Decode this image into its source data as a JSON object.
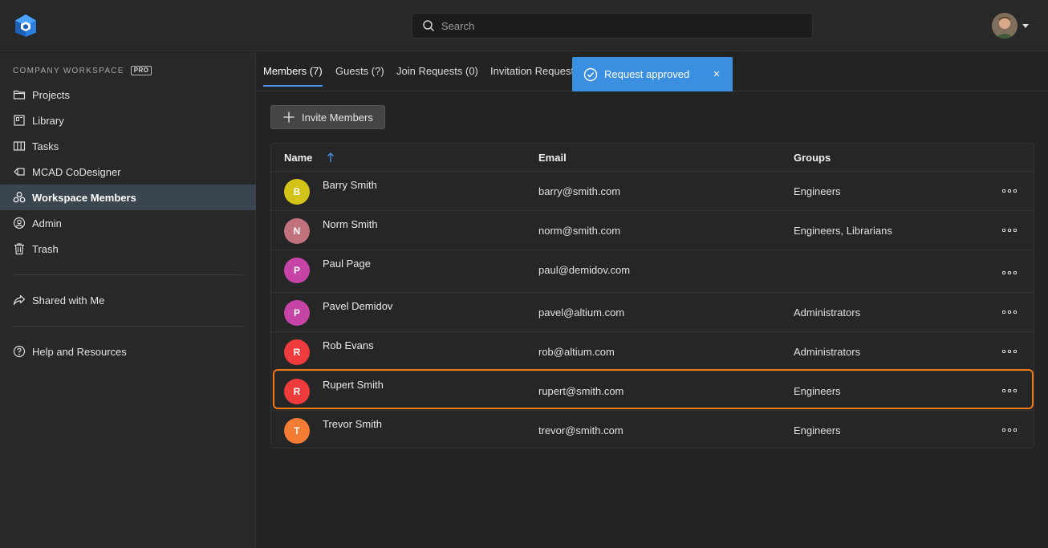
{
  "header": {
    "search_placeholder": "Search"
  },
  "sidebar": {
    "workspace_label": "COMPANY WORKSPACE",
    "pro_badge": "PRO",
    "items": [
      {
        "label": "Projects",
        "icon": "folder-icon"
      },
      {
        "label": "Library",
        "icon": "library-icon"
      },
      {
        "label": "Tasks",
        "icon": "tasks-board-icon"
      },
      {
        "label": "MCAD CoDesigner",
        "icon": "mcad-icon"
      },
      {
        "label": "Workspace Members",
        "icon": "members-icon",
        "active": true
      },
      {
        "label": "Admin",
        "icon": "admin-user-icon"
      },
      {
        "label": "Trash",
        "icon": "trash-icon"
      }
    ],
    "shared_label": "Shared with Me",
    "help_label": "Help and Resources"
  },
  "tabs": [
    {
      "label": "Members (7)",
      "active": true
    },
    {
      "label": "Guests (?)"
    },
    {
      "label": "Join Requests (0)"
    },
    {
      "label": "Invitation Requests"
    }
  ],
  "toast": {
    "message": "Request approved",
    "close": "×"
  },
  "invite_button": "Invite Members",
  "table": {
    "headers": {
      "name": "Name",
      "email": "Email",
      "groups": "Groups"
    },
    "rows": [
      {
        "initial": "B",
        "color": "#d4c419",
        "name": "Barry Smith",
        "email": "barry@smith.com",
        "groups": "Engineers"
      },
      {
        "initial": "N",
        "color": "#c2727c",
        "name": "Norm Smith",
        "email": "norm@smith.com",
        "groups": "Engineers, Librarians"
      },
      {
        "initial": "P",
        "color": "#c544a6",
        "name": "Paul Page",
        "email": "paul@demidov.com",
        "groups": ""
      },
      {
        "initial": "P",
        "color": "#c544a6",
        "name": "Pavel Demidov",
        "email": "pavel@altium.com",
        "groups": "Administrators"
      },
      {
        "initial": "R",
        "color": "#ee3b3b",
        "name": "Rob Evans",
        "email": "rob@altium.com",
        "groups": "Administrators"
      },
      {
        "initial": "R",
        "color": "#ee3b3b",
        "name": "Rupert Smith",
        "email": "rupert@smith.com",
        "groups": "Engineers",
        "highlighted": true
      },
      {
        "initial": "T",
        "color": "#f47c35",
        "name": "Trevor Smith",
        "email": "trevor@smith.com",
        "groups": "Engineers"
      }
    ]
  },
  "colors": {
    "accent": "#4a90e2",
    "toast": "#3a8fe0",
    "highlight": "#f07a1a"
  }
}
